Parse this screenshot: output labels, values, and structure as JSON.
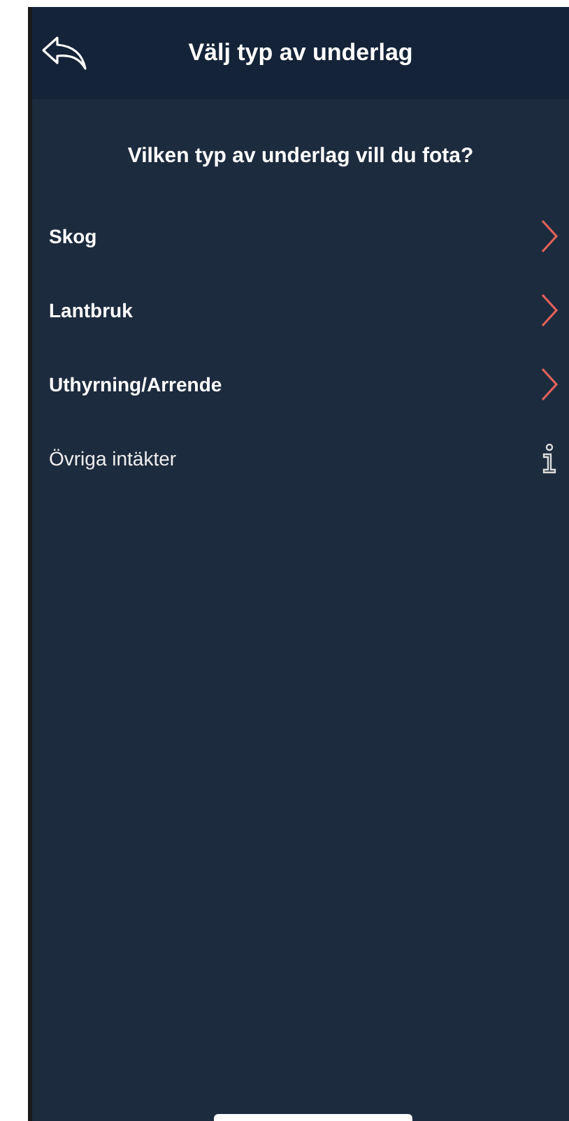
{
  "header": {
    "title": "Välj typ av underlag"
  },
  "question": "Vilken typ av underlag vill du fota?",
  "items": [
    {
      "label": "Skog",
      "kind": "chevron"
    },
    {
      "label": "Lantbruk",
      "kind": "chevron"
    },
    {
      "label": "Uthyrning/Arrende",
      "kind": "chevron"
    },
    {
      "label": "Övriga intäkter",
      "kind": "info"
    }
  ]
}
